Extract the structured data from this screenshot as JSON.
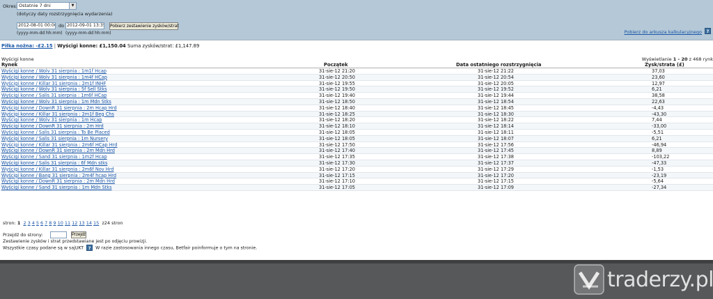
{
  "filter": {
    "period_label": "Okres:",
    "period_value": "Ostatnie 7 dni",
    "period_hint": "(dotyczy daty rozstrzygnięcia wydarzenia)",
    "from_value": "2012-08-01 00:00",
    "to_label": "do",
    "to_value": "2012-09-01 13:35",
    "date_format_hint": "(yyyy-mm-dd hh:mm)",
    "fetch_button": "Pobierz zestawienie zysków/strat",
    "export_link": "Pobierz do arkusza kalkulacyjnego"
  },
  "summary": {
    "football": "Piłka nożna: -£2.15",
    "separator": "|",
    "horse": "Wyścigi konne: £1,150.04",
    "total_label": "Suma zysków/strat:",
    "total_value": "£1,147.89"
  },
  "table": {
    "section_label": "Wyścigi konne",
    "showing_prefix": "Wyświetlanie",
    "showing_range": "1 - 20",
    "showing_suffix": "z 468 rynk",
    "headers": {
      "market": "Rynek",
      "start": "Początek",
      "settled": "Data ostatniego rozstrzygnięcia",
      "pl": "Zysk/strata (£)"
    },
    "rows": [
      {
        "market": "Wyścigi konne / Wolv 31 sierpnia : 1m1f Hcap",
        "start": "31-sie-12 21:20",
        "settled": "31-sie-12 21:22",
        "pl": "37,03"
      },
      {
        "market": "Wyścigi konne / Wolv 31 sierpnia : 1m4f HCap",
        "start": "31-sie-12 20:50",
        "settled": "31-sie-12 20:54",
        "pl": "23,60"
      },
      {
        "market": "Wyścigi konne / Killar 31 sierpnia : 2m1f INHF",
        "start": "31-sie-12 19:55",
        "settled": "31-sie-12 20:05",
        "pl": "12,97"
      },
      {
        "market": "Wyścigi konne / Wolv 31 sierpnia : 5f Sell Stks",
        "start": "31-sie-12 19:50",
        "settled": "31-sie-12 19:52",
        "pl": "6,21"
      },
      {
        "market": "Wyścigi konne / Salis 31 sierpnia : 1m6f HCap",
        "start": "31-sie-12 19:40",
        "settled": "31-sie-12 19:44",
        "pl": "38,58"
      },
      {
        "market": "Wyścigi konne / Wolv 31 sierpnia : 1m Mdn Stks",
        "start": "31-sie-12 18:50",
        "settled": "31-sie-12 18:54",
        "pl": "22,63"
      },
      {
        "market": "Wyścigi konne / DownR 31 sierpnia : 2m Hcap Hrd",
        "start": "31-sie-12 18:40",
        "settled": "31-sie-12 18:45",
        "pl": "-4,43"
      },
      {
        "market": "Wyścigi konne / Killar 31 sierpnia : 2m1f Beg Chs",
        "start": "31-sie-12 18:25",
        "settled": "31-sie-12 18:30",
        "pl": "-43,30"
      },
      {
        "market": "Wyścigi konne / Wolv 31 sierpnia : 1m Hcap",
        "start": "31-sie-12 18:20",
        "settled": "31-sie-12 18:22",
        "pl": "7,44"
      },
      {
        "market": "Wyścigi konne / DownR 31 sierpnia : 2m Hrd",
        "start": "31-sie-12 18:10",
        "settled": "31-sie-12 18:14",
        "pl": "-33,00"
      },
      {
        "market": "Wyścigi konne / Salis 31 sierpnia : To Be Placed",
        "start": "31-sie-12 18:05",
        "settled": "31-sie-12 18:11",
        "pl": "-5,51"
      },
      {
        "market": "Wyścigi konne / Salis 31 sierpnia : 1m Nursery",
        "start": "31-sie-12 18:05",
        "settled": "31-sie-12 18:07",
        "pl": "6,21"
      },
      {
        "market": "Wyścigi konne / Killar 31 sierpnia : 2m6f HCap Hrd",
        "start": "31-sie-12 17:50",
        "settled": "31-sie-12 17:56",
        "pl": "-46,94"
      },
      {
        "market": "Wyścigi konne / DownR 31 sierpnia : 2m Mdn Hrd",
        "start": "31-sie-12 17:40",
        "settled": "31-sie-12 17:45",
        "pl": "8,89"
      },
      {
        "market": "Wyścigi konne / Sand 31 sierpnia : 1m2f Hcap",
        "start": "31-sie-12 17:35",
        "settled": "31-sie-12 17:38",
        "pl": "-103,22"
      },
      {
        "market": "Wyścigi konne / Salis 31 sierpnia : 6f Mdn stks",
        "start": "31-sie-12 17:30",
        "settled": "31-sie-12 17:37",
        "pl": "-47,33"
      },
      {
        "market": "Wyścigi konne / Killar 31 sierpnia : 2m6f Nov Hrd",
        "start": "31-sie-12 17:20",
        "settled": "31-sie-12 17:29",
        "pl": "-1,53"
      },
      {
        "market": "Wyścigi konne / Bang 31 sierpnia : 2m4f hcap Hrd",
        "start": "31-sie-12 17:15",
        "settled": "31-sie-12 17:20",
        "pl": "-23,19"
      },
      {
        "market": "Wyścigi konne / DownR 31 sierpnia : 2m Mdn Hrd",
        "start": "31-sie-12 17:10",
        "settled": "31-sie-12 17:15",
        "pl": "-5,64"
      },
      {
        "market": "Wyścigi konne / Sand 31 sierpnia : 1m Mdn Stks",
        "start": "31-sie-12 17:05",
        "settled": "31-sie-12 17:09",
        "pl": "-27,34"
      }
    ]
  },
  "pager": {
    "prefix": "stron:",
    "current": "1",
    "pages": [
      "2",
      "3",
      "4",
      "5",
      "6",
      "7",
      "8",
      "9",
      "10",
      "11",
      "12",
      "13",
      "14",
      "15"
    ],
    "suffix": "z24 stron"
  },
  "goto": {
    "label": "Przejdź do strony:",
    "button": "Przejdź"
  },
  "notes": {
    "line1": "Zestawienie zysków i strat przedstawiane jest po odjęciu prowizji.",
    "line2a": "Wszystkie czasy podane są w sajUKT",
    "line2b": "W razie zastosowania innego czasu, Betfair poinformuje o tym na stronie."
  },
  "footer": {
    "brand": "traderzy.pl"
  },
  "colors": {
    "panel": "#b4c8d7",
    "link": "#1a57a8",
    "footer": "#57585a"
  }
}
